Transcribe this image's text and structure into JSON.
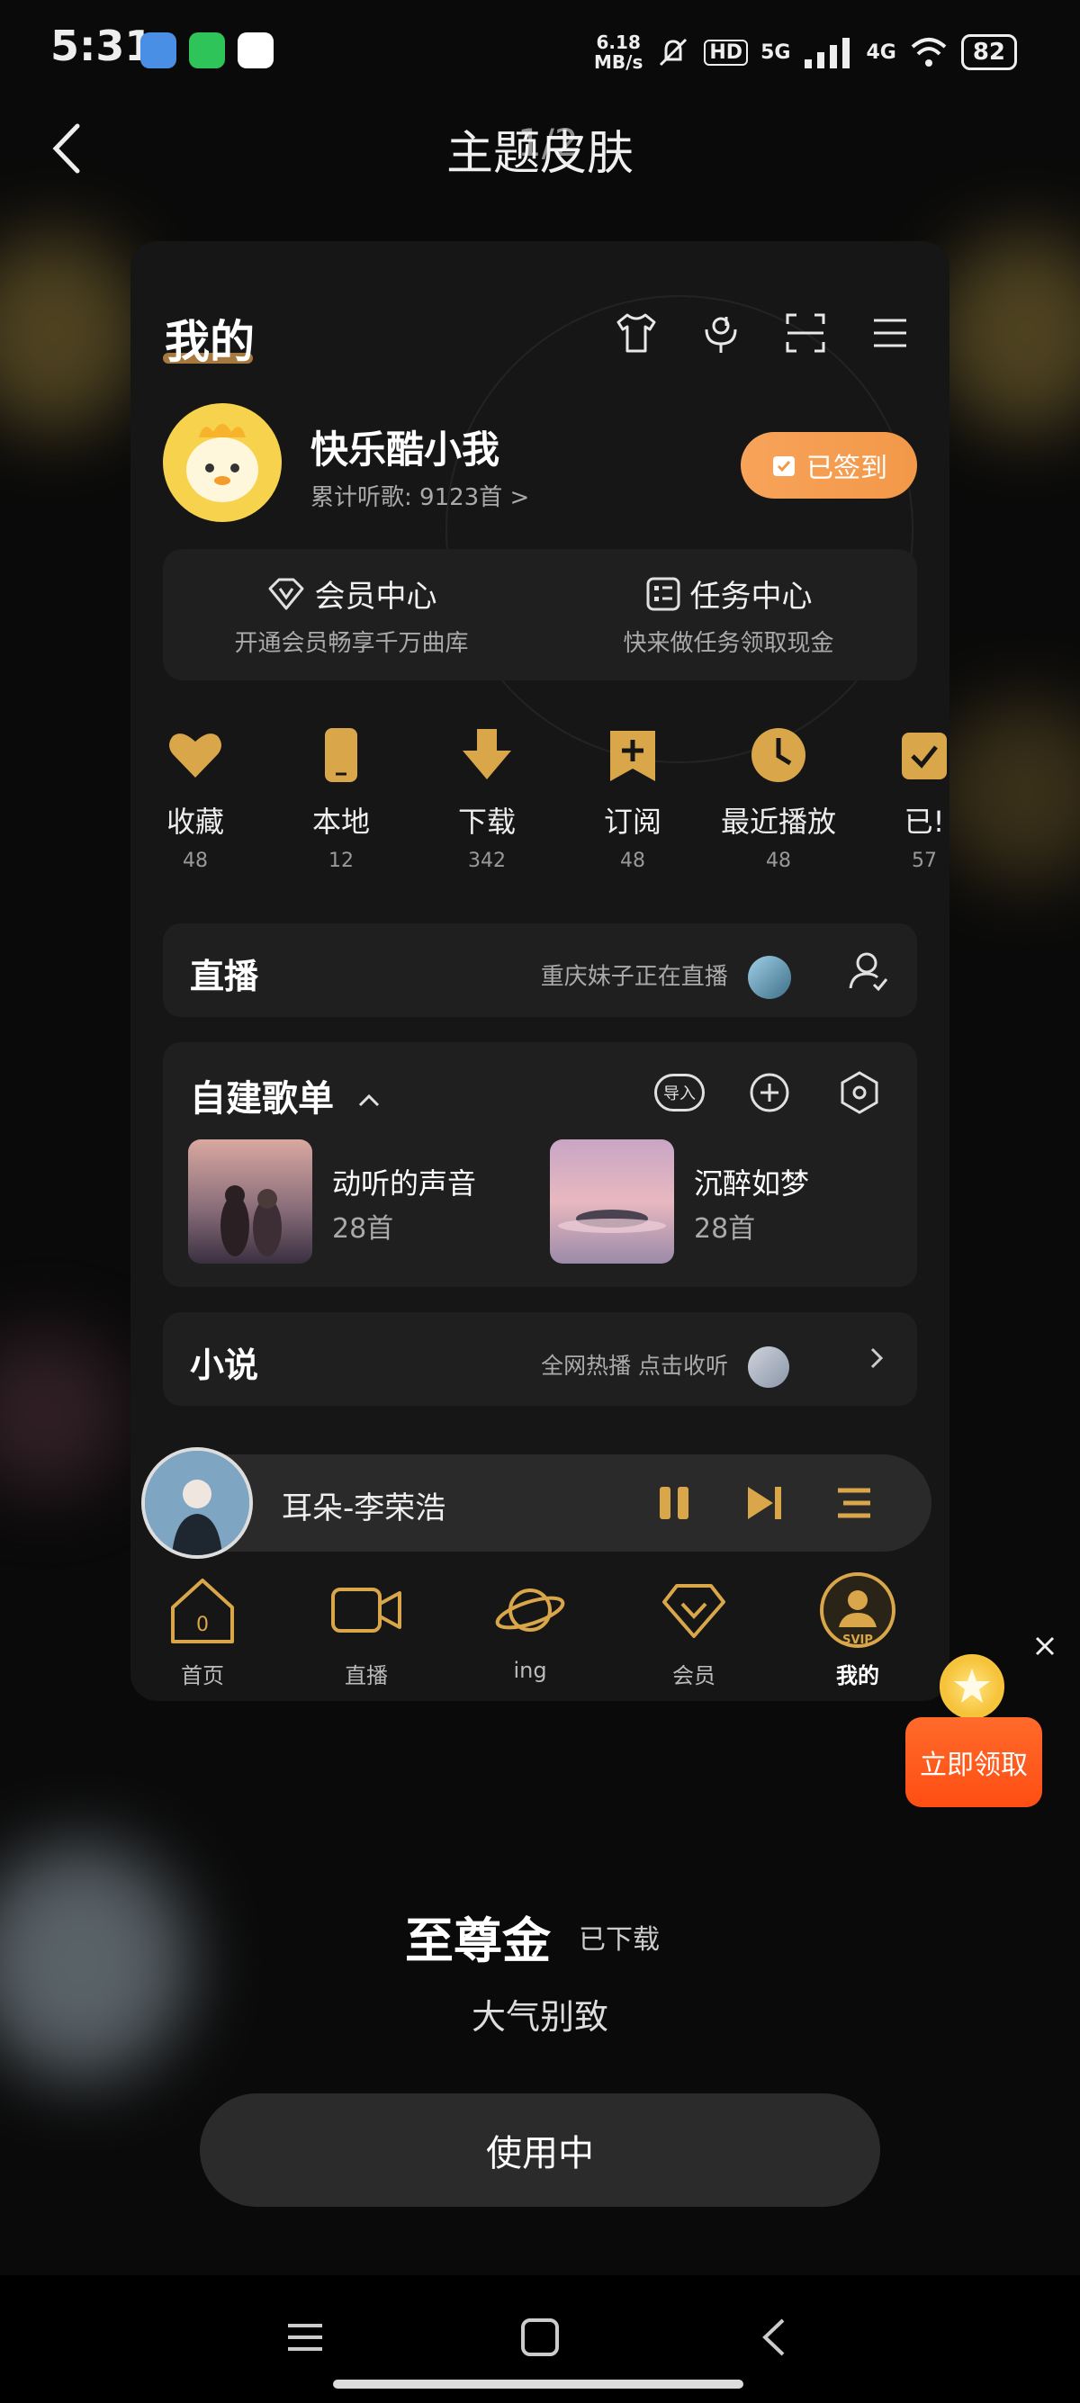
{
  "status_bar": {
    "time": "5:31",
    "net_speed_top": "6.18",
    "net_speed_unit": "MB/s",
    "hd": "HD",
    "network_5g": "5G",
    "network_4g": "4G",
    "battery": "82"
  },
  "header": {
    "title": "主题皮肤",
    "page_index": "1/2"
  },
  "preview": {
    "title": "我的",
    "user": {
      "name": "快乐酷小我",
      "listen_count": "累计听歌: 9123首 >"
    },
    "signed_label": "已签到",
    "member_center": {
      "title": "会员中心",
      "subtitle": "开通会员畅享千万曲库"
    },
    "task_center": {
      "title": "任务中心",
      "subtitle": "快来做任务领取现金"
    },
    "quick_items": [
      {
        "label": "收藏",
        "count": "48"
      },
      {
        "label": "本地",
        "count": "12"
      },
      {
        "label": "下载",
        "count": "342"
      },
      {
        "label": "订阅",
        "count": "48"
      },
      {
        "label": "最近播放",
        "count": "48"
      },
      {
        "label": "已!",
        "count": "57"
      }
    ],
    "live": {
      "title": "直播",
      "text": "重庆妹子正在直播"
    },
    "playlist": {
      "title": "自建歌单",
      "import_label": "导入",
      "items": [
        {
          "name": "动听的声音",
          "count": "28首"
        },
        {
          "name": "沉醉如梦",
          "count": "28首"
        }
      ]
    },
    "novel": {
      "title": "小说",
      "text": "全网热播 点击收听"
    },
    "player": {
      "song": "耳朵-李荣浩"
    },
    "tabs": [
      {
        "label": "首页"
      },
      {
        "label": "直播"
      },
      {
        "label": "ing"
      },
      {
        "label": "会员"
      },
      {
        "label": "我的",
        "badge": "SVIP"
      }
    ]
  },
  "reward": {
    "label": "立即领取"
  },
  "theme": {
    "name": "至尊金",
    "download_status": "已下载",
    "description": "大气别致",
    "use_button": "使用中"
  },
  "colors": {
    "gold": "#d9a64a",
    "orange_button": "#f29848",
    "reward_orange": "#ff5a1c",
    "card_bg": "#1f1f1f"
  }
}
